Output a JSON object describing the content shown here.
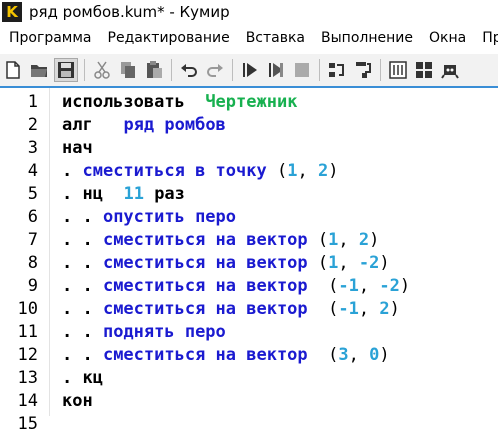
{
  "window": {
    "title": "ряд ромбов.kum* - Кумир",
    "app_icon_letter": "K"
  },
  "menu": [
    {
      "label": "Программа"
    },
    {
      "label": "Редактирование"
    },
    {
      "label": "Вставка"
    },
    {
      "label": "Выполнение"
    },
    {
      "label": "Окна"
    },
    {
      "label": "Прав"
    }
  ],
  "toolbar": {
    "buttons": [
      "new-file-icon",
      "open-folder-icon",
      "save-icon",
      "cut-icon",
      "copy-icon",
      "paste-icon",
      "undo-icon",
      "redo-icon",
      "run-icon",
      "run-step-icon",
      "stop-icon",
      "step-over-icon",
      "step-into-icon",
      "ruler-icon",
      "grid-icon",
      "robot-icon"
    ]
  },
  "colors": {
    "keyword": "#000000",
    "name": "#1a1ad0",
    "actor": "#17b04f",
    "number": "#2aa2d6",
    "accent_border": "#3a8ed6"
  },
  "code": {
    "lines": [
      {
        "number": "1",
        "indent": "",
        "parts": [
          {
            "text": "использовать",
            "kind": "kw"
          },
          {
            "text": "  ",
            "kind": "pn"
          },
          {
            "text": "Чертежник",
            "kind": "act"
          }
        ]
      },
      {
        "number": "2",
        "indent": "",
        "parts": [
          {
            "text": "алг",
            "kind": "kw"
          },
          {
            "text": "   ",
            "kind": "pn"
          },
          {
            "text": "ряд ромбов",
            "kind": "nm"
          }
        ]
      },
      {
        "number": "3",
        "indent": "",
        "parts": [
          {
            "text": "нач",
            "kind": "kw"
          }
        ]
      },
      {
        "number": "4",
        "indent": ". ",
        "parts": [
          {
            "text": "сместиться в точку",
            "kind": "nm"
          },
          {
            "text": " (",
            "kind": "pn"
          },
          {
            "text": "1",
            "kind": "num"
          },
          {
            "text": ", ",
            "kind": "pn"
          },
          {
            "text": "2",
            "kind": "num"
          },
          {
            "text": ")",
            "kind": "pn"
          }
        ]
      },
      {
        "number": "5",
        "indent": ". ",
        "parts": [
          {
            "text": "нц",
            "kind": "kw"
          },
          {
            "text": "  ",
            "kind": "pn"
          },
          {
            "text": "11",
            "kind": "num"
          },
          {
            "text": " ",
            "kind": "pn"
          },
          {
            "text": "раз",
            "kind": "kw"
          }
        ]
      },
      {
        "number": "6",
        "indent": ". . ",
        "parts": [
          {
            "text": "опустить перо",
            "kind": "nm"
          }
        ]
      },
      {
        "number": "7",
        "indent": ". . ",
        "parts": [
          {
            "text": "сместиться на вектор",
            "kind": "nm"
          },
          {
            "text": " (",
            "kind": "pn"
          },
          {
            "text": "1",
            "kind": "num"
          },
          {
            "text": ", ",
            "kind": "pn"
          },
          {
            "text": "2",
            "kind": "num"
          },
          {
            "text": ")",
            "kind": "pn"
          }
        ]
      },
      {
        "number": "8",
        "indent": ". . ",
        "parts": [
          {
            "text": "сместиться на вектор",
            "kind": "nm"
          },
          {
            "text": " (",
            "kind": "pn"
          },
          {
            "text": "1",
            "kind": "num"
          },
          {
            "text": ", ",
            "kind": "pn"
          },
          {
            "text": "-2",
            "kind": "num"
          },
          {
            "text": ")",
            "kind": "pn"
          }
        ]
      },
      {
        "number": "9",
        "indent": ". . ",
        "parts": [
          {
            "text": "сместиться на вектор",
            "kind": "nm"
          },
          {
            "text": "  (",
            "kind": "pn"
          },
          {
            "text": "-1",
            "kind": "num"
          },
          {
            "text": ", ",
            "kind": "pn"
          },
          {
            "text": "-2",
            "kind": "num"
          },
          {
            "text": ")",
            "kind": "pn"
          }
        ]
      },
      {
        "number": "10",
        "indent": ". . ",
        "parts": [
          {
            "text": "сместиться на вектор",
            "kind": "nm"
          },
          {
            "text": "  (",
            "kind": "pn"
          },
          {
            "text": "-1",
            "kind": "num"
          },
          {
            "text": ", ",
            "kind": "pn"
          },
          {
            "text": "2",
            "kind": "num"
          },
          {
            "text": ")",
            "kind": "pn"
          }
        ]
      },
      {
        "number": "11",
        "indent": ". . ",
        "parts": [
          {
            "text": "поднять перо",
            "kind": "nm"
          }
        ]
      },
      {
        "number": "12",
        "indent": ". . ",
        "parts": [
          {
            "text": "сместиться на вектор",
            "kind": "nm"
          },
          {
            "text": "  (",
            "kind": "pn"
          },
          {
            "text": "3",
            "kind": "num"
          },
          {
            "text": ", ",
            "kind": "pn"
          },
          {
            "text": "0",
            "kind": "num"
          },
          {
            "text": ")",
            "kind": "pn"
          }
        ]
      },
      {
        "number": "13",
        "indent": ". ",
        "parts": [
          {
            "text": "кц",
            "kind": "kw"
          }
        ]
      },
      {
        "number": "14",
        "indent": "",
        "parts": [
          {
            "text": "кон",
            "kind": "kw"
          }
        ]
      },
      {
        "number": "15",
        "indent": "",
        "parts": []
      }
    ]
  }
}
